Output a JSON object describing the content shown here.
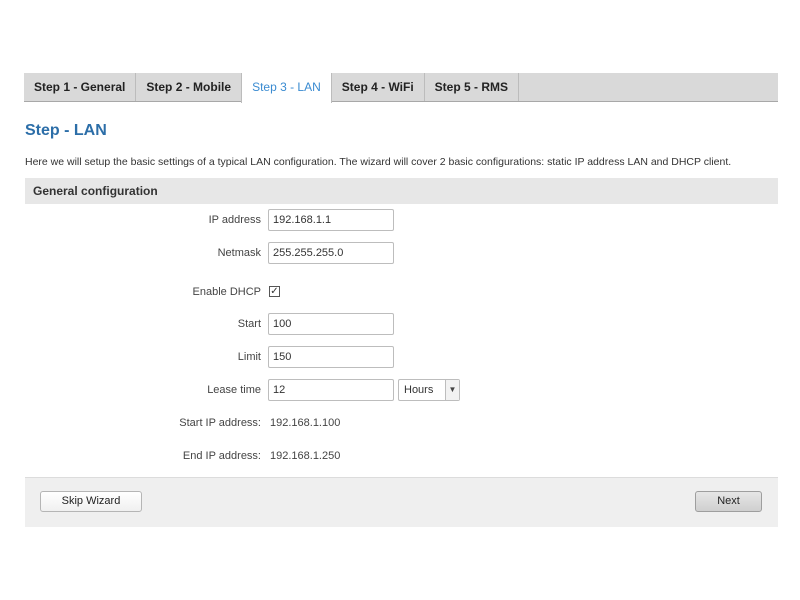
{
  "tabs": [
    {
      "label": "Step 1 - General",
      "active": false
    },
    {
      "label": "Step 2 - Mobile",
      "active": false
    },
    {
      "label": "Step 3 - LAN",
      "active": true
    },
    {
      "label": "Step 4 - WiFi",
      "active": false
    },
    {
      "label": "Step 5 - RMS",
      "active": false
    }
  ],
  "page": {
    "title": "Step - LAN",
    "description": "Here we will setup the basic settings of a typical LAN configuration. The wizard will cover 2 basic configurations: static IP address LAN and DHCP client."
  },
  "section": {
    "title": "General configuration"
  },
  "form": {
    "ip_address": {
      "label": "IP address",
      "value": "192.168.1.1"
    },
    "netmask": {
      "label": "Netmask",
      "value": "255.255.255.0"
    },
    "enable_dhcp": {
      "label": "Enable DHCP",
      "checked": true,
      "mark": "✓"
    },
    "start": {
      "label": "Start",
      "value": "100"
    },
    "limit": {
      "label": "Limit",
      "value": "150"
    },
    "lease_time": {
      "label": "Lease time",
      "value": "12",
      "unit": "Hours"
    },
    "start_ip": {
      "label": "Start IP address:",
      "value": "192.168.1.100"
    },
    "end_ip": {
      "label": "End IP address:",
      "value": "192.168.1.250"
    }
  },
  "footer": {
    "skip_label": "Skip Wizard",
    "next_label": "Next"
  },
  "icons": {
    "select_arrow": "chevron-down-icon",
    "checkbox": "check-icon"
  },
  "colors": {
    "active_tab": "#3a8bd1",
    "title": "#2c6ea8",
    "tab_bar": "#d9d9d9",
    "section_header": "#e7e7e7",
    "footer": "#efefef"
  }
}
